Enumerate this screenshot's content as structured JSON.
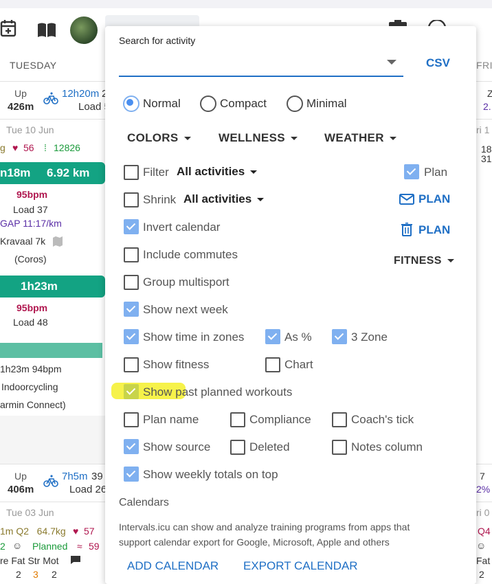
{
  "menu": {
    "search_label": "Search for activity",
    "csv_label": "CSV",
    "view_modes": [
      "Normal",
      "Compact",
      "Minimal"
    ],
    "dropdowns": {
      "colors": "COLORS",
      "wellness": "WELLNESS",
      "weather": "WEATHER",
      "fitness": "FITNESS"
    },
    "filter": {
      "label": "Filter",
      "value": "All activities",
      "checked": false
    },
    "shrink": {
      "label": "Shrink",
      "value": "All activities",
      "checked": false
    },
    "plan_checkbox": {
      "label": "Plan",
      "checked": true
    },
    "email_plan": "PLAN",
    "delete_plan": "PLAN",
    "options": {
      "invert_calendar": {
        "label": "Invert calendar",
        "checked": true
      },
      "include_commutes": {
        "label": "Include commutes",
        "checked": false
      },
      "group_multisport": {
        "label": "Group multisport",
        "checked": false
      },
      "show_next_week": {
        "label": "Show next week",
        "checked": true
      },
      "show_time_in_zones": {
        "label": "Show time in zones",
        "checked": true
      },
      "as_percent": {
        "label": "As %",
        "checked": true
      },
      "three_zone": {
        "label": "3 Zone",
        "checked": true
      },
      "show_fitness": {
        "label": "Show fitness",
        "checked": false
      },
      "chart": {
        "label": "Chart",
        "checked": false
      },
      "show_past_planned": {
        "label": "Show past planned workouts",
        "checked": true
      },
      "plan_name": {
        "label": "Plan name",
        "checked": false
      },
      "compliance": {
        "label": "Compliance",
        "checked": false
      },
      "coachs_tick": {
        "label": "Coach's tick",
        "checked": false
      },
      "show_source": {
        "label": "Show source",
        "checked": true
      },
      "deleted": {
        "label": "Deleted",
        "checked": false
      },
      "notes_column": {
        "label": "Notes column",
        "checked": false
      },
      "weekly_totals_top": {
        "label": "Show weekly totals on top",
        "checked": true
      }
    },
    "calendars_heading": "Calendars",
    "calendars_text_1": "Intervals.icu can show and analyze training programs from apps that",
    "calendars_text_2": "support calendar export for Google, Microsoft, Apple and others",
    "add_calendar": "ADD CALENDAR",
    "export_calendar": "EXPORT CALENDAR"
  },
  "calendar": {
    "day_header": "TUESDAY",
    "right_header": "FRI",
    "week1": {
      "up_label": "Up",
      "up_value": "426m",
      "time": "12h20m",
      "time_suffix": "2",
      "load": "Load 5"
    },
    "day1_date": "Tue 10 Jun",
    "day1_hrv": "56",
    "day1_steps": "12826",
    "day1_g": "g",
    "act1": {
      "head": "n18m     6.92 km",
      "bpm": "95bpm",
      "load": "Load 37",
      "gap": "GAP 11:17/km",
      "name": "Kravaal 7k",
      "source": "(Coros)"
    },
    "act2": {
      "head": "1h23m",
      "bpm": "95bpm",
      "load": "Load 48",
      "detail": "1h23m 94bpm",
      "name": "Indoorcycling",
      "source": "armin Connect)"
    },
    "week2": {
      "up_label": "Up",
      "up_value": "406m",
      "time": "7h5m",
      "time_suffix": "39",
      "load": "Load 26"
    },
    "day2_date": "Tue 03 Jun",
    "day2_line1": "1m Q2   64.7kg",
    "day2_hrv": "57",
    "day2_planned": "Planned",
    "day2_num": "2",
    "day2_bp": "59",
    "day2_line3": "re Fat Str Mot",
    "day2_vals": [
      "2",
      "3",
      "2"
    ],
    "right_col": {
      "z": "Z",
      "z_val": "2.",
      "ri1": "ri 1",
      "v18": "18",
      "v31": "31",
      "r7": "7",
      "r2": "2%",
      "ri0": "ri 0",
      "q4": "Q4",
      "fat": "Fat",
      "two": "2"
    }
  },
  "colors": {
    "accent": "#1f6fc5",
    "green": "#13a383",
    "checkbox_on": "#7fb0f0",
    "highlight": "#f5f02a"
  }
}
